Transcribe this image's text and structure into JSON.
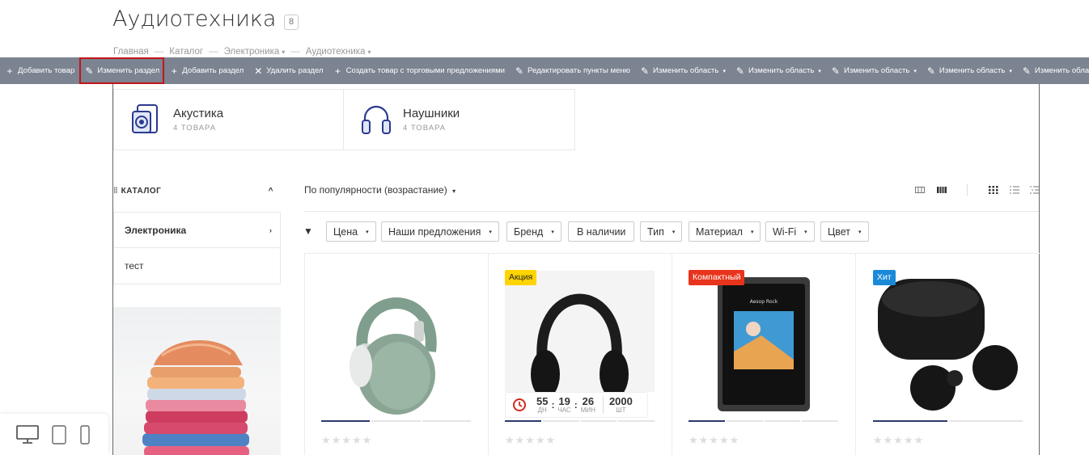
{
  "page": {
    "title": "Аудиотехника",
    "count": "8"
  },
  "breadcrumb": [
    {
      "label": "Главная"
    },
    {
      "label": "Каталог"
    },
    {
      "label": "Электроника"
    },
    {
      "label": "Аудиотехника"
    }
  ],
  "toolbar": [
    {
      "label": "Добавить товар",
      "icon": "plus-icon"
    },
    {
      "label": "Изменить раздел",
      "icon": "pencil-icon"
    },
    {
      "label": "Добавить раздел",
      "icon": "plus-icon"
    },
    {
      "label": "Удалить раздел",
      "icon": "cross-icon"
    },
    {
      "label": "Создать товар с торговыми предложениями",
      "icon": "plus-icon"
    },
    {
      "label": "Редактировать пункты меню",
      "icon": "pencil-icon"
    },
    {
      "label": "Изменить область",
      "icon": "pencil-icon"
    },
    {
      "label": "Изменить область",
      "icon": "pencil-icon"
    },
    {
      "label": "Изменить область",
      "icon": "pencil-icon"
    },
    {
      "label": "Изменить область",
      "icon": "pencil-icon"
    },
    {
      "label": "Изменить область",
      "icon": "pencil-icon"
    }
  ],
  "categories": [
    {
      "name": "Акустика",
      "count": "4 ТОВАРА",
      "icon": "speaker-icon"
    },
    {
      "name": "Наушники",
      "count": "4 ТОВАРА",
      "icon": "headphones-icon"
    }
  ],
  "sidebar": {
    "title": "КАТАЛОГ",
    "items": [
      {
        "label": "Электроника"
      },
      {
        "label": "тест"
      }
    ]
  },
  "sort": {
    "label": "По популярности (возрастание)"
  },
  "filters": [
    "Цена",
    "Наши предложения",
    "Бренд",
    "В наличии",
    "Тип",
    "Материал",
    "Wi-Fi",
    "Цвет"
  ],
  "products": [
    {
      "badge": "",
      "stars": "★★★★★"
    },
    {
      "badge": "Акция",
      "badge_color": "#ffd400",
      "stars": "★★★★★"
    },
    {
      "badge": "Компактный",
      "badge_color": "#e8341c",
      "stars": "★★★★★"
    },
    {
      "badge": "Хит",
      "badge_color": "#1a8ad8",
      "stars": "★★★★★"
    }
  ],
  "timer": {
    "days": "55",
    "days_label": "ДН",
    "hours": "19",
    "hours_label": "ЧАС",
    "minutes": "26",
    "minutes_label": "МИН",
    "qty": "2000",
    "qty_label": "ШТ"
  },
  "colors": {
    "toolbar": "#7c8391",
    "accent": "#2b3a6b",
    "highlight": "#c0161b"
  }
}
